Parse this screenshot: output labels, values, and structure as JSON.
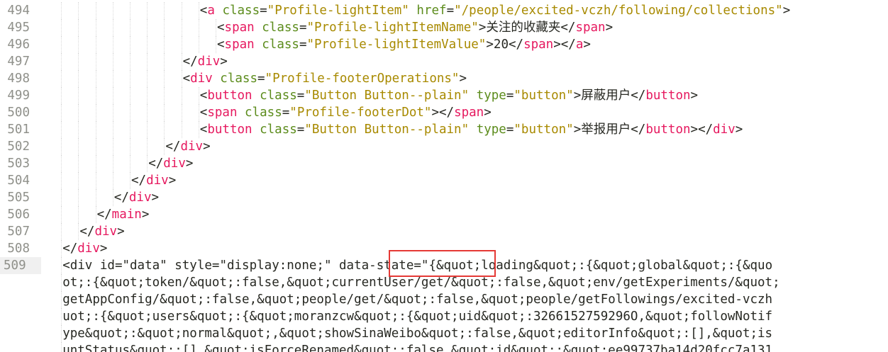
{
  "editor": {
    "lines": [
      {
        "n": "494",
        "indent": 10,
        "tokens": [
          [
            "punct",
            "<"
          ],
          [
            "tag",
            "a"
          ],
          [
            "punct",
            " "
          ],
          [
            "attr",
            "class"
          ],
          [
            "punct",
            "="
          ],
          [
            "str",
            "\"Profile-lightItem\""
          ],
          [
            "punct",
            " "
          ],
          [
            "attr",
            "href"
          ],
          [
            "punct",
            "="
          ],
          [
            "str",
            "\"/people/excited-vczh/following/collections\""
          ],
          [
            "punct",
            ">"
          ]
        ]
      },
      {
        "n": "495",
        "indent": 11,
        "tokens": [
          [
            "punct",
            "<"
          ],
          [
            "tag",
            "span"
          ],
          [
            "punct",
            " "
          ],
          [
            "attr",
            "class"
          ],
          [
            "punct",
            "="
          ],
          [
            "str",
            "\"Profile-lightItemName\""
          ],
          [
            "punct",
            ">"
          ],
          [
            "text",
            "关注的收藏夹"
          ],
          [
            "punct",
            "</"
          ],
          [
            "tag",
            "span"
          ],
          [
            "punct",
            ">"
          ]
        ]
      },
      {
        "n": "496",
        "indent": 11,
        "tokens": [
          [
            "punct",
            "<"
          ],
          [
            "tag",
            "span"
          ],
          [
            "punct",
            " "
          ],
          [
            "attr",
            "class"
          ],
          [
            "punct",
            "="
          ],
          [
            "str",
            "\"Profile-lightItemValue\""
          ],
          [
            "punct",
            ">"
          ],
          [
            "text",
            "20"
          ],
          [
            "punct",
            "</"
          ],
          [
            "tag",
            "span"
          ],
          [
            "punct",
            "></"
          ],
          [
            "tag",
            "a"
          ],
          [
            "punct",
            ">"
          ]
        ]
      },
      {
        "n": "497",
        "indent": 9,
        "tokens": [
          [
            "punct",
            "</"
          ],
          [
            "tag",
            "div"
          ],
          [
            "punct",
            ">"
          ]
        ]
      },
      {
        "n": "498",
        "indent": 9,
        "tokens": [
          [
            "punct",
            "<"
          ],
          [
            "tag",
            "div"
          ],
          [
            "punct",
            " "
          ],
          [
            "attr",
            "class"
          ],
          [
            "punct",
            "="
          ],
          [
            "str",
            "\"Profile-footerOperations\""
          ],
          [
            "punct",
            ">"
          ]
        ]
      },
      {
        "n": "499",
        "indent": 10,
        "tokens": [
          [
            "punct",
            "<"
          ],
          [
            "tag",
            "button"
          ],
          [
            "punct",
            " "
          ],
          [
            "attr",
            "class"
          ],
          [
            "punct",
            "="
          ],
          [
            "str",
            "\"Button Button--plain\""
          ],
          [
            "punct",
            " "
          ],
          [
            "attr",
            "type"
          ],
          [
            "punct",
            "="
          ],
          [
            "str",
            "\"button\""
          ],
          [
            "punct",
            ">"
          ],
          [
            "text",
            "屏蔽用户"
          ],
          [
            "punct",
            "</"
          ],
          [
            "tag",
            "button"
          ],
          [
            "punct",
            ">"
          ]
        ]
      },
      {
        "n": "500",
        "indent": 10,
        "tokens": [
          [
            "punct",
            "<"
          ],
          [
            "tag",
            "span"
          ],
          [
            "punct",
            " "
          ],
          [
            "attr",
            "class"
          ],
          [
            "punct",
            "="
          ],
          [
            "str",
            "\"Profile-footerDot\""
          ],
          [
            "punct",
            "></"
          ],
          [
            "tag",
            "span"
          ],
          [
            "punct",
            ">"
          ]
        ]
      },
      {
        "n": "501",
        "indent": 10,
        "tokens": [
          [
            "punct",
            "<"
          ],
          [
            "tag",
            "button"
          ],
          [
            "punct",
            " "
          ],
          [
            "attr",
            "class"
          ],
          [
            "punct",
            "="
          ],
          [
            "str",
            "\"Button Button--plain\""
          ],
          [
            "punct",
            " "
          ],
          [
            "attr",
            "type"
          ],
          [
            "punct",
            "="
          ],
          [
            "str",
            "\"button\""
          ],
          [
            "punct",
            ">"
          ],
          [
            "text",
            "举报用户"
          ],
          [
            "punct",
            "</"
          ],
          [
            "tag",
            "button"
          ],
          [
            "punct",
            "></"
          ],
          [
            "tag",
            "div"
          ],
          [
            "punct",
            ">"
          ]
        ]
      },
      {
        "n": "502",
        "indent": 8,
        "tokens": [
          [
            "punct",
            "</"
          ],
          [
            "tag",
            "div"
          ],
          [
            "punct",
            ">"
          ]
        ]
      },
      {
        "n": "503",
        "indent": 7,
        "tokens": [
          [
            "punct",
            "</"
          ],
          [
            "tag",
            "div"
          ],
          [
            "punct",
            ">"
          ]
        ]
      },
      {
        "n": "504",
        "indent": 6,
        "tokens": [
          [
            "punct",
            "</"
          ],
          [
            "tag",
            "div"
          ],
          [
            "punct",
            ">"
          ]
        ]
      },
      {
        "n": "505",
        "indent": 5,
        "tokens": [
          [
            "punct",
            "</"
          ],
          [
            "tag",
            "div"
          ],
          [
            "punct",
            ">"
          ]
        ]
      },
      {
        "n": "506",
        "indent": 4,
        "tokens": [
          [
            "punct",
            "</"
          ],
          [
            "tag",
            "main"
          ],
          [
            "punct",
            ">"
          ]
        ]
      },
      {
        "n": "507",
        "indent": 3,
        "tokens": [
          [
            "punct",
            "</"
          ],
          [
            "tag",
            "div"
          ],
          [
            "punct",
            ">"
          ]
        ]
      },
      {
        "n": "508",
        "indent": 2,
        "tokens": [
          [
            "punct",
            "</"
          ],
          [
            "tag",
            "div"
          ],
          [
            "punct",
            ">"
          ]
        ]
      },
      {
        "n": "509",
        "indent": 2,
        "active": true,
        "tokens": [
          [
            "punct",
            "<div id=\"data\" style=\"display:none;\" data-state=\""
          ],
          [
            "punct",
            "{&quot;loading&quot;:{&quot;global&quot;:{&quo"
          ]
        ]
      },
      {
        "n": "",
        "indent": 2,
        "tokens": [
          [
            "punct",
            "ot;:{&quot;token/&quot;:false,&quot;currentUser/get/&quot;:false,&quot;env/getExperiments/&quot;"
          ]
        ]
      },
      {
        "n": "",
        "indent": 2,
        "tokens": [
          [
            "punct",
            "getAppConfig/&quot;:false,&quot;people/get/&quot;:false,&quot;people/getFollowings/excited-vczh"
          ]
        ]
      },
      {
        "n": "",
        "indent": 2,
        "tokens": [
          [
            "punct",
            "uot;:{&quot;users&quot;:{&quot;moranzcw&quot;:{&quot;uid&quot;:3266152759296O,&quot;followNotif"
          ]
        ]
      },
      {
        "n": "",
        "indent": 2,
        "tokens": [
          [
            "punct",
            "ype&quot;:&quot;normal&quot;,&quot;showSinaWeibo&quot;:false,&quot;editorInfo&quot;:[],&quot;is"
          ]
        ]
      },
      {
        "n": "",
        "indent": 2,
        "tokens": [
          [
            "punct",
            "untStatus&quot;:[],&quot;isForceRenamed&quot;:false,&quot;id&quot;:&quot;ee99737ba14d20fcc7a131"
          ]
        ]
      }
    ]
  },
  "colors": {
    "tag": "#e6195f",
    "attr": "#5c8c1c",
    "string": "#a88a00",
    "text": "#272822",
    "line_number": "#8f908a",
    "highlight": "#e53935"
  }
}
